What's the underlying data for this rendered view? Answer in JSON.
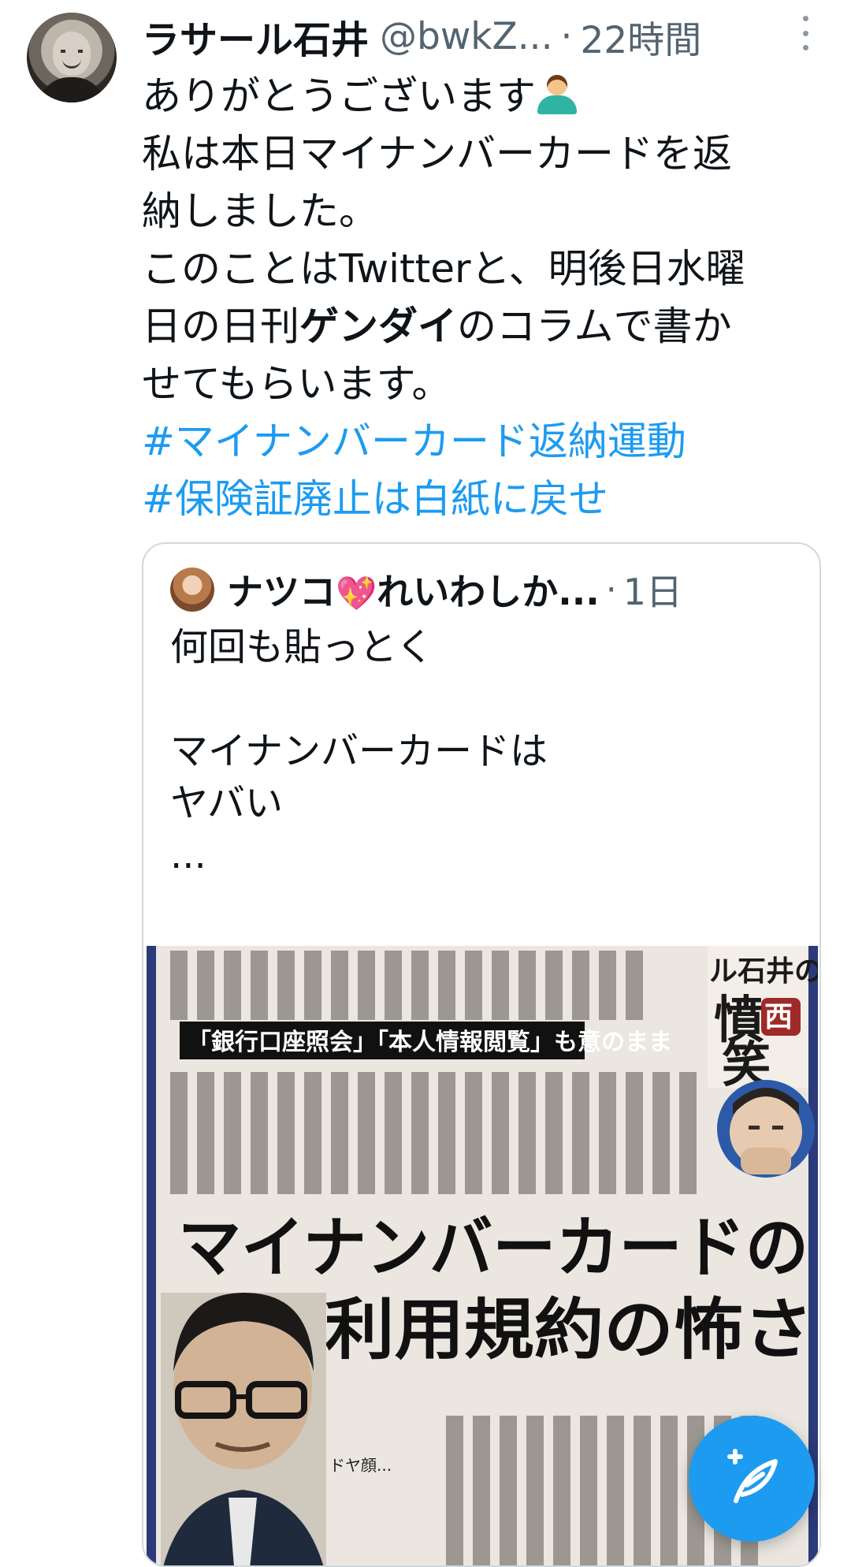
{
  "tweet": {
    "display_name": "ラサール石井",
    "handle": "@bwkZ...",
    "separator": "·",
    "time": "22時間",
    "lines": [
      "ありがとうございます",
      "私は本日マイナンバーカードを返",
      "納しました。",
      "このことはTwitterと、明後日水曜",
      "日の日刊",
      "ゲンダイ",
      "のコラムで書か",
      "せてもらいます。"
    ],
    "hashtags": [
      "#マイナンバーカード返納運動",
      "#保険証廃止は白紙に戻せ"
    ],
    "emoji_icon": "person-tipping-hand-emoji"
  },
  "quoted_tweet": {
    "display_name": "ナツコ",
    "heart": "💖",
    "display_name_suffix": "れいわしか...",
    "separator": "·",
    "time": "1日",
    "lines": [
      "何回も貼っとく",
      "",
      "マイナンバーカードは",
      "ヤバい",
      "..."
    ],
    "image": {
      "banner": "「銀行口座照会」「本人情報閲覧」も意のまま",
      "headline_1": "マイナンバーカードの",
      "headline_2": "利用規約の怖さ",
      "column_title_1": "ル石井の",
      "column_title_2": "憤",
      "column_title_3": "西",
      "column_title_4": "笑",
      "caption": "ドヤ顔..."
    }
  },
  "fab": {
    "icon": "compose-tweet-icon",
    "color": "#1d9bf0"
  },
  "colors": {
    "link": "#1d9bf0",
    "secondary_text": "#536471",
    "border": "#cfd9de"
  }
}
